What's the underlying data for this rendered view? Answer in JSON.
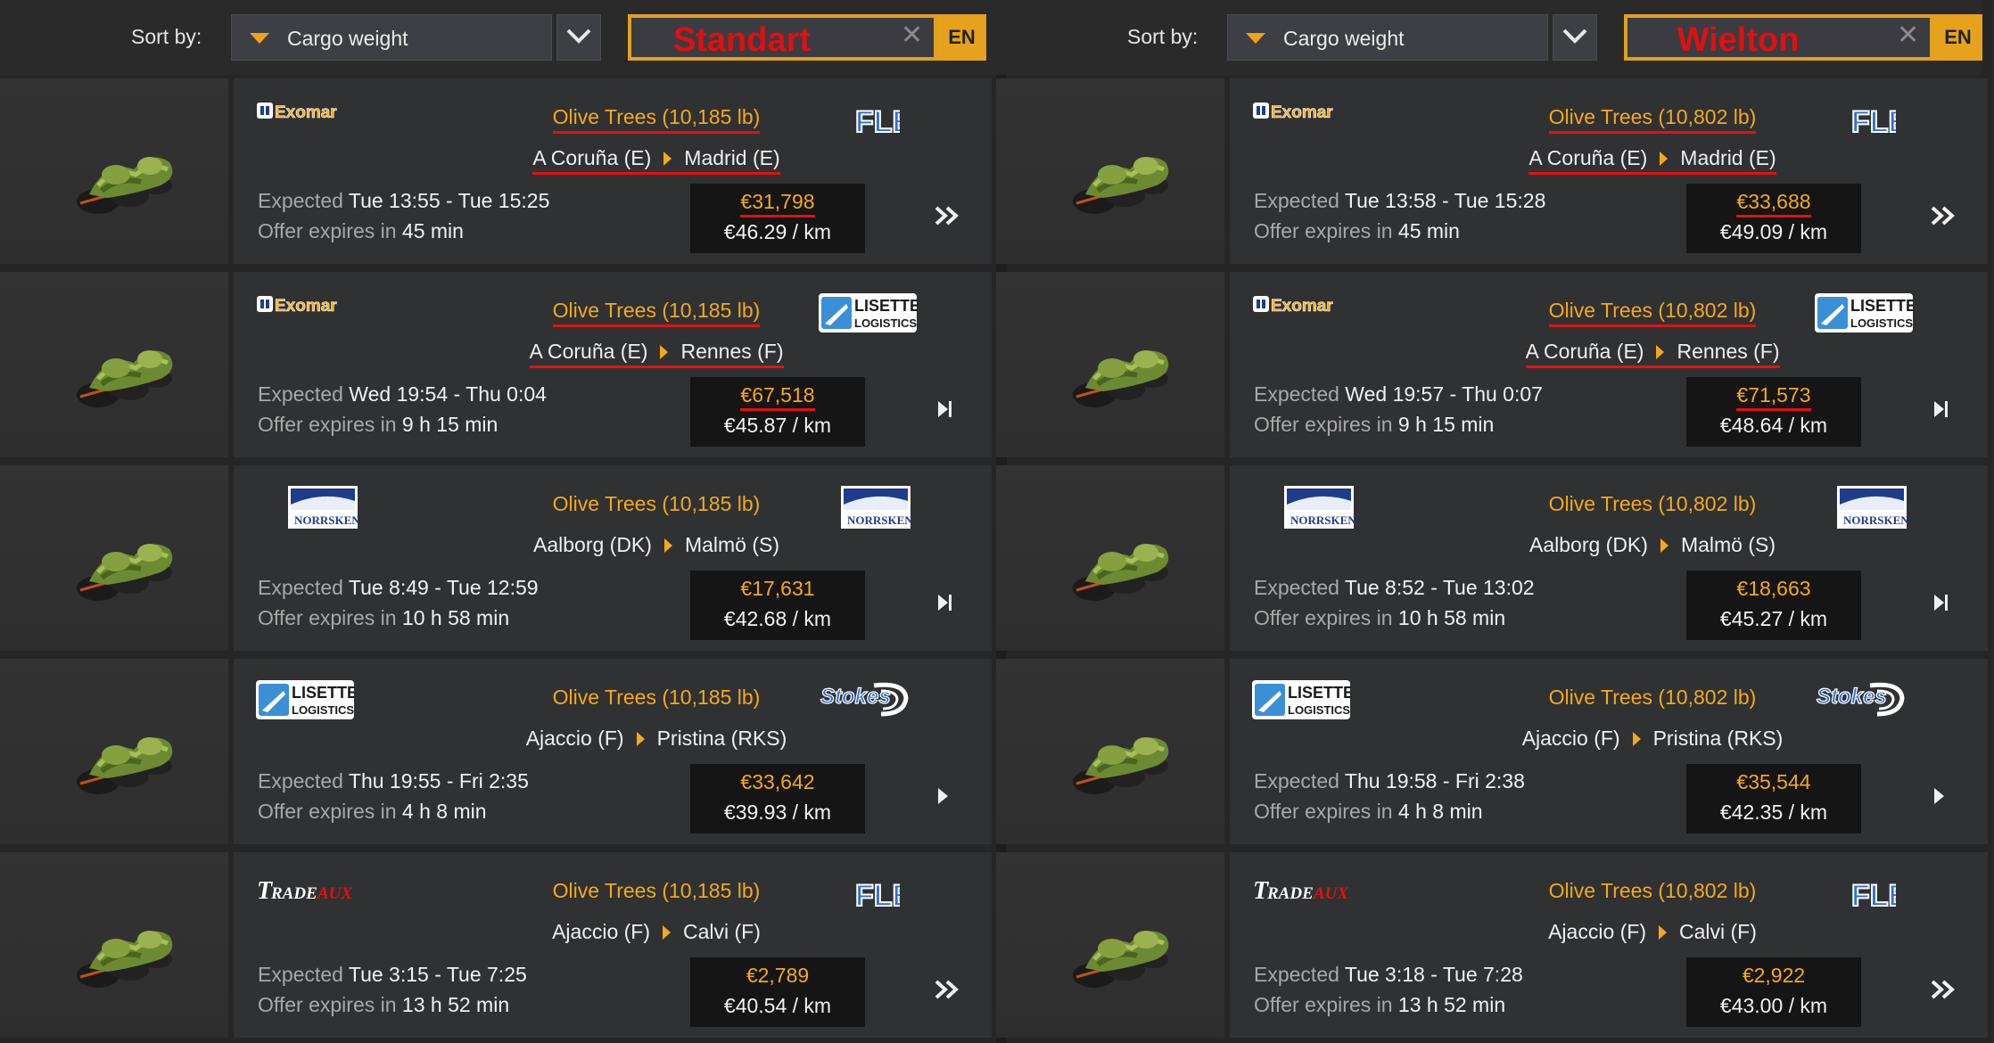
{
  "panels": [
    {
      "sort_label": "Sort by:",
      "sort_value": "Cargo weight",
      "search_value": "Standart",
      "lang": "EN",
      "jobs": [
        {
          "company_from": "Exomar",
          "company_to": "FLE",
          "cargo": "Olive Trees (10,185 lb)",
          "from": "A Coruña (E)",
          "to": "Madrid (E)",
          "expected_label": "Expected",
          "expected": "Tue 13:55 - Tue 15:25",
          "expires_label": "Offer expires in",
          "expires": "45 min",
          "price": "€31,798",
          "perkm": "€46.29 / km",
          "chevron": "double",
          "underline_cargo": true,
          "underline_route": true,
          "underline_price": true
        },
        {
          "company_from": "Exomar",
          "company_to": "LISETTE LOGISTICS",
          "cargo": "Olive Trees (10,185 lb)",
          "from": "A Coruña (E)",
          "to": "Rennes (F)",
          "expected_label": "Expected",
          "expected": "Wed 19:54 - Thu 0:04",
          "expires_label": "Offer expires in",
          "expires": "9 h 15 min",
          "price": "€67,518",
          "perkm": "€45.87 / km",
          "chevron": "single-bar",
          "underline_cargo": true,
          "underline_route": true,
          "underline_price": true
        },
        {
          "company_from": "NORRSKEN",
          "company_to": "NORRSKEN",
          "cargo": "Olive Trees (10,185 lb)",
          "from": "Aalborg (DK)",
          "to": "Malmö (S)",
          "expected_label": "Expected",
          "expected": "Tue 8:49 - Tue 12:59",
          "expires_label": "Offer expires in",
          "expires": "10 h 58 min",
          "price": "€17,631",
          "perkm": "€42.68 / km",
          "chevron": "single-bar",
          "underline_cargo": false,
          "underline_route": false,
          "underline_price": false
        },
        {
          "company_from": "LISETTE LOGISTICS",
          "company_to": "Stokes",
          "cargo": "Olive Trees (10,185 lb)",
          "from": "Ajaccio (F)",
          "to": "Pristina (RKS)",
          "expected_label": "Expected",
          "expected": "Thu 19:55 - Fri 2:35",
          "expires_label": "Offer expires in",
          "expires": "4 h 8 min",
          "price": "€33,642",
          "perkm": "€39.93 / km",
          "chevron": "single",
          "underline_cargo": false,
          "underline_route": false,
          "underline_price": false
        },
        {
          "company_from": "TRADEAUX",
          "company_to": "FLE",
          "cargo": "Olive Trees (10,185 lb)",
          "from": "Ajaccio (F)",
          "to": "Calvi (F)",
          "expected_label": "Expected",
          "expected": "Tue 3:15 - Tue 7:25",
          "expires_label": "Offer expires in",
          "expires": "13 h 52 min",
          "price": "€2,789",
          "perkm": "€40.54 / km",
          "chevron": "double",
          "underline_cargo": false,
          "underline_route": false,
          "underline_price": false
        }
      ]
    },
    {
      "sort_label": "Sort by:",
      "sort_value": "Cargo weight",
      "search_value": "Wielton",
      "lang": "EN",
      "jobs": [
        {
          "company_from": "Exomar",
          "company_to": "FLE",
          "cargo": "Olive Trees (10,802 lb)",
          "from": "A Coruña (E)",
          "to": "Madrid (E)",
          "expected_label": "Expected",
          "expected": "Tue 13:58 - Tue 15:28",
          "expires_label": "Offer expires in",
          "expires": "45 min",
          "price": "€33,688",
          "perkm": "€49.09 / km",
          "chevron": "double",
          "underline_cargo": true,
          "underline_route": true,
          "underline_price": true
        },
        {
          "company_from": "Exomar",
          "company_to": "LISETTE LOGISTICS",
          "cargo": "Olive Trees (10,802 lb)",
          "from": "A Coruña (E)",
          "to": "Rennes (F)",
          "expected_label": "Expected",
          "expected": "Wed 19:57 - Thu 0:07",
          "expires_label": "Offer expires in",
          "expires": "9 h 15 min",
          "price": "€71,573",
          "perkm": "€48.64 / km",
          "chevron": "single-bar",
          "underline_cargo": true,
          "underline_route": true,
          "underline_price": true
        },
        {
          "company_from": "NORRSKEN",
          "company_to": "NORRSKEN",
          "cargo": "Olive Trees (10,802 lb)",
          "from": "Aalborg (DK)",
          "to": "Malmö (S)",
          "expected_label": "Expected",
          "expected": "Tue 8:52 - Tue 13:02",
          "expires_label": "Offer expires in",
          "expires": "10 h 58 min",
          "price": "€18,663",
          "perkm": "€45.27 / km",
          "chevron": "single-bar",
          "underline_cargo": false,
          "underline_route": false,
          "underline_price": false
        },
        {
          "company_from": "LISETTE LOGISTICS",
          "company_to": "Stokes",
          "cargo": "Olive Trees (10,802 lb)",
          "from": "Ajaccio (F)",
          "to": "Pristina (RKS)",
          "expected_label": "Expected",
          "expected": "Thu 19:58 - Fri 2:38",
          "expires_label": "Offer expires in",
          "expires": "4 h 8 min",
          "price": "€35,544",
          "perkm": "€42.35 / km",
          "chevron": "single",
          "underline_cargo": false,
          "underline_route": false,
          "underline_price": false
        },
        {
          "company_from": "TRADEAUX",
          "company_to": "FLE",
          "cargo": "Olive Trees (10,802 lb)",
          "from": "Ajaccio (F)",
          "to": "Calvi (F)",
          "expected_label": "Expected",
          "expected": "Tue 3:18 - Tue 7:28",
          "expires_label": "Offer expires in",
          "expires": "13 h 52 min",
          "price": "€2,922",
          "perkm": "€43.00 / km",
          "chevron": "double",
          "underline_cargo": false,
          "underline_route": false,
          "underline_price": false
        }
      ]
    }
  ],
  "colors": {
    "accent": "#f3a91c",
    "underline": "#e51010",
    "search_text": "#e01010",
    "card": "#303133",
    "pricebox": "#151515"
  }
}
